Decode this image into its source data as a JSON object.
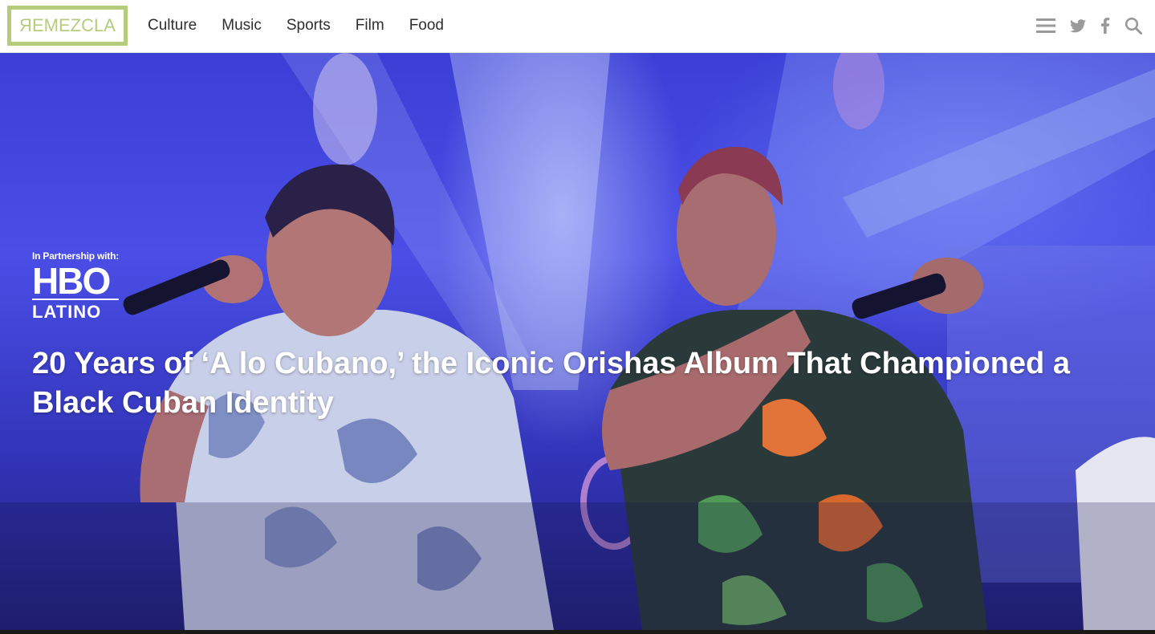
{
  "brand": {
    "logo_text_reversed": "R",
    "logo_text_rest": "EMEZCLA",
    "logo_color": "#b5cc7d"
  },
  "nav": {
    "items": [
      {
        "label": "Culture"
      },
      {
        "label": "Music"
      },
      {
        "label": "Sports"
      },
      {
        "label": "Film"
      },
      {
        "label": "Food"
      }
    ]
  },
  "tools": {
    "icons": [
      "menu-icon",
      "twitter-icon",
      "facebook-icon",
      "search-icon"
    ],
    "icon_color": "#9a9a9a"
  },
  "hero": {
    "partner_label": "In Partnership with:",
    "partner_logo_text": "HBO",
    "partner_logo_sub": "LATINO",
    "headline": "20 Years of ‘A lo Cubano,’ the Iconic Orishas Album That Championed a Black Cuban Identity",
    "dominant_color": "#3b3fd6"
  }
}
